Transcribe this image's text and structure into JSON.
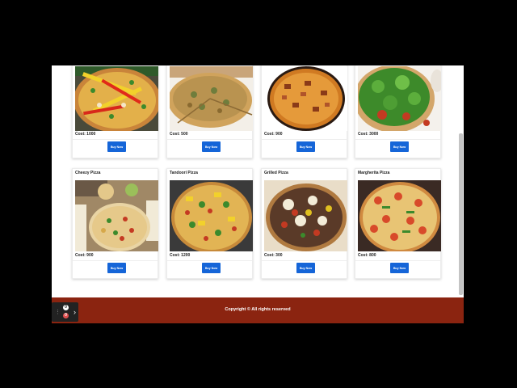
{
  "products": [
    {
      "title": "",
      "cost": "Cost: 1000",
      "button": "Buy Now"
    },
    {
      "title": "",
      "cost": "Cost: 500",
      "button": "Buy Now"
    },
    {
      "title": "",
      "cost": "Cost: 900",
      "button": "Buy Now"
    },
    {
      "title": "",
      "cost": "Cost: 3000",
      "button": "Buy Now"
    },
    {
      "title": "Cheezy Pizza",
      "cost": "Cost: 900",
      "button": "Buy Now"
    },
    {
      "title": "Tandoori Pizza",
      "cost": "Cost: 1200",
      "button": "Buy Now"
    },
    {
      "title": "Grilled Pizza",
      "cost": "Cost: 300",
      "button": "Buy Now"
    },
    {
      "title": "Margherita Pizza",
      "cost": "Cost: 800",
      "button": "Buy Now"
    }
  ],
  "footer": {
    "text": "Copyright © All rights reserved"
  },
  "overlay": {
    "badge_top": "0",
    "badge_bottom": "0",
    "grip_icon": "grip-icon",
    "chevron_icon": "chevron-right-icon"
  },
  "colors": {
    "button": "#1565d8",
    "footer": "#8b2410"
  }
}
